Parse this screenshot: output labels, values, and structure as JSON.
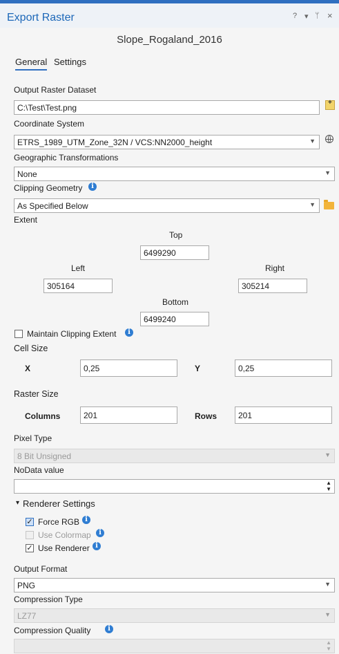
{
  "window": {
    "title": "Export Raster",
    "help": "?",
    "menu": "▾",
    "pin": "ᛘ",
    "close": "×"
  },
  "layer_name": "Slope_Rogaland_2016",
  "tabs": [
    {
      "label": "General",
      "active": true
    },
    {
      "label": "Settings",
      "active": false
    }
  ],
  "output_raster": {
    "label": "Output Raster Dataset",
    "value": "C:\\Test\\Test.png"
  },
  "coordinate_system": {
    "label": "Coordinate System",
    "value": "ETRS_1989_UTM_Zone_32N / VCS:NN2000_height"
  },
  "geo_transform": {
    "label": "Geographic Transformations",
    "value": "None"
  },
  "clipping_geometry": {
    "label": "Clipping Geometry",
    "value": "As Specified Below"
  },
  "extent": {
    "label": "Extent",
    "top_label": "Top",
    "top": "6499290",
    "left_label": "Left",
    "left": "305164",
    "right_label": "Right",
    "right": "305214",
    "bottom_label": "Bottom",
    "bottom": "6499240"
  },
  "maintain_clipping": {
    "label": "Maintain Clipping Extent",
    "checked": false
  },
  "cell_size": {
    "label": "Cell Size",
    "x_label": "X",
    "x": "0,25",
    "y_label": "Y",
    "y": "0,25"
  },
  "raster_size": {
    "label": "Raster Size",
    "columns_label": "Columns",
    "columns": "201",
    "rows_label": "Rows",
    "rows": "201"
  },
  "pixel_type": {
    "label": "Pixel Type",
    "value": "8 Bit Unsigned"
  },
  "nodata": {
    "label": "NoData value",
    "value": ""
  },
  "renderer": {
    "label": "Renderer Settings",
    "force_rgb": {
      "label": "Force RGB",
      "checked": true
    },
    "use_colormap": {
      "label": "Use Colormap",
      "checked": false
    },
    "use_renderer": {
      "label": "Use Renderer",
      "checked": true
    }
  },
  "output_format": {
    "label": "Output Format",
    "value": "PNG"
  },
  "compression_type": {
    "label": "Compression Type",
    "value": "LZ77"
  },
  "compression_quality": {
    "label": "Compression Quality",
    "value": ""
  },
  "icons": {
    "info": "info-icon",
    "folder": "folder-icon",
    "globe": "globe-icon",
    "add_file": "add-file-icon"
  },
  "colors": {
    "accent": "#2f6fc0",
    "title": "#1c67b8",
    "info": "#2f7dd2",
    "folder": "#f2b43a"
  }
}
